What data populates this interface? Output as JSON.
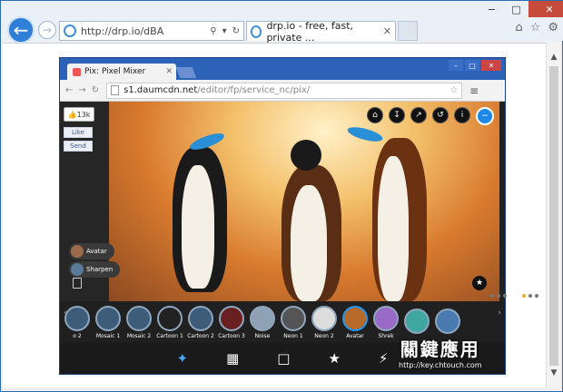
{
  "ie": {
    "address": "http://drp.io/dBA",
    "tab_title": "drp.io - free, fast, private ...",
    "win_min": "−",
    "win_max": "□",
    "win_close": "✕",
    "tab_close": "✕",
    "right_icons": [
      "home-icon",
      "star-icon",
      "gear-icon"
    ]
  },
  "chrome": {
    "tab_title": "Pix: Pixel Mixer",
    "tab_close": "✕",
    "url_host": "s1.daumcdn.net",
    "url_path": "/editor/fp/service_nc/pix/",
    "menu": "≡"
  },
  "pix": {
    "fb_count": "13k",
    "fb_like": "Like",
    "fb_send": "Send",
    "pill_avatar": "Avatar",
    "pill_sharpen": "Sharpen",
    "filters": [
      "o 2",
      "Mosaic 1",
      "Mosaic 2",
      "Cartoon 1",
      "Cartoon 2",
      "Cartoon 3",
      "Noise",
      "Neon 1",
      "Neon 2",
      "Avatar",
      "Shrek",
      "",
      ""
    ]
  },
  "watermark": {
    "title": "關鍵應用",
    "url": "http://key.chtouch.com"
  },
  "colors": {
    "accent": "#2f7fd8",
    "chrome_blue": "#2d62b9",
    "selected_filter": "#2196f3"
  }
}
